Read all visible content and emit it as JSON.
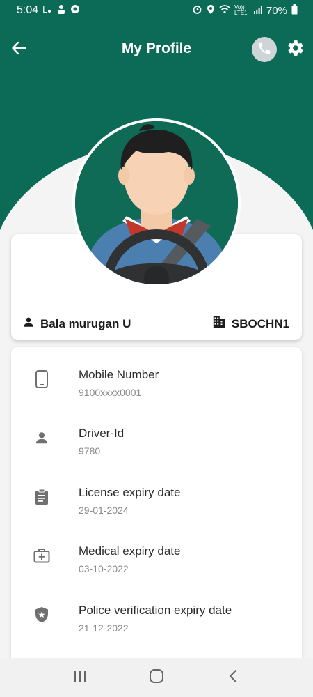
{
  "status_bar": {
    "time": "5:04",
    "network_label": "Vo)) LTE1",
    "battery": "70%"
  },
  "header": {
    "title": "My Profile",
    "back_icon": "arrow-left-icon",
    "call_icon": "phone-icon",
    "settings_icon": "gear-icon"
  },
  "profile": {
    "name": "Bala murugan U",
    "depot": "SBOCHN1",
    "avatar": "driver-avatar"
  },
  "details": [
    {
      "icon": "mobile-phone-icon",
      "label": "Mobile Number",
      "value": "9100xxxx0001"
    },
    {
      "icon": "person-icon",
      "label": "Driver-Id",
      "value": "9780"
    },
    {
      "icon": "clipboard-icon",
      "label": "License expiry date",
      "value": "29-01-2024"
    },
    {
      "icon": "medical-kit-icon",
      "label": "Medical expiry date",
      "value": "03-10-2022"
    },
    {
      "icon": "police-shield-icon",
      "label": "Police verification expiry date",
      "value": "21-12-2022"
    }
  ],
  "nav_bar": {
    "recents_icon": "recents-icon",
    "home_icon": "home-icon",
    "back_icon": "nav-back-icon"
  },
  "colors": {
    "primary": "#0c6b57",
    "accent_card": "#ffffff",
    "background": "#f4f4f5"
  }
}
